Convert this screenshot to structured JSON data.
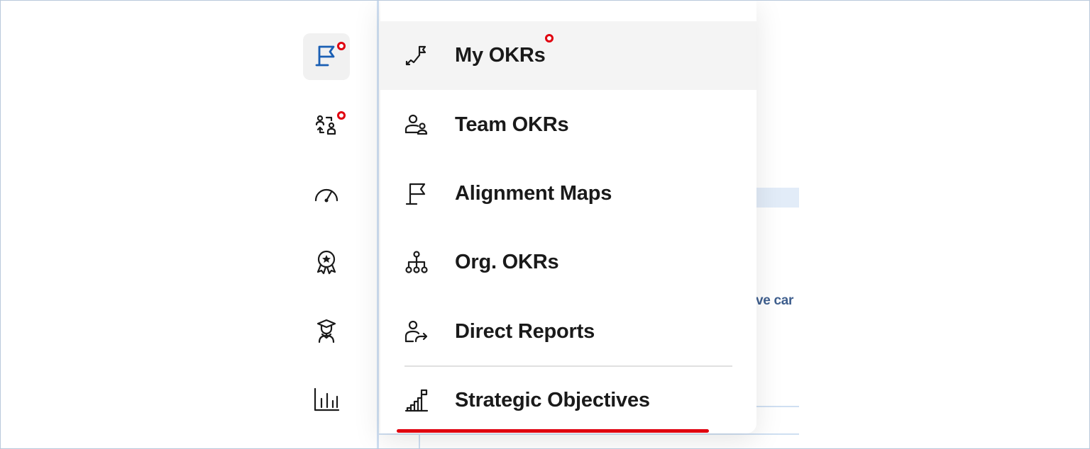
{
  "menu": {
    "items": [
      {
        "label": "My OKRs",
        "icon": "growth-flag-icon",
        "active": true,
        "notification": true
      },
      {
        "label": "Team OKRs",
        "icon": "team-icon",
        "active": false,
        "notification": false
      },
      {
        "label": "Alignment Maps",
        "icon": "flag-icon",
        "active": false,
        "notification": false
      },
      {
        "label": "Org. OKRs",
        "icon": "org-chart-icon",
        "active": false,
        "notification": false
      },
      {
        "label": "Direct Reports",
        "icon": "user-share-icon",
        "active": false,
        "notification": false
      },
      {
        "label": "Strategic Objectives",
        "icon": "strategy-icon",
        "active": false,
        "notification": false
      }
    ]
  },
  "rail": {
    "items": [
      {
        "icon": "flag-icon",
        "active": true,
        "notification": true
      },
      {
        "icon": "people-swap-icon",
        "active": false,
        "notification": true
      },
      {
        "icon": "gauge-icon",
        "active": false,
        "notification": false
      },
      {
        "icon": "award-icon",
        "active": false,
        "notification": false
      },
      {
        "icon": "graduate-icon",
        "active": false,
        "notification": false
      },
      {
        "icon": "bar-chart-icon",
        "active": false,
        "notification": false
      }
    ]
  },
  "background": {
    "partial_text": "ive car"
  },
  "colors": {
    "accent": "#1a5fb4",
    "notification": "#e0000f",
    "underline": "#e0000f"
  }
}
